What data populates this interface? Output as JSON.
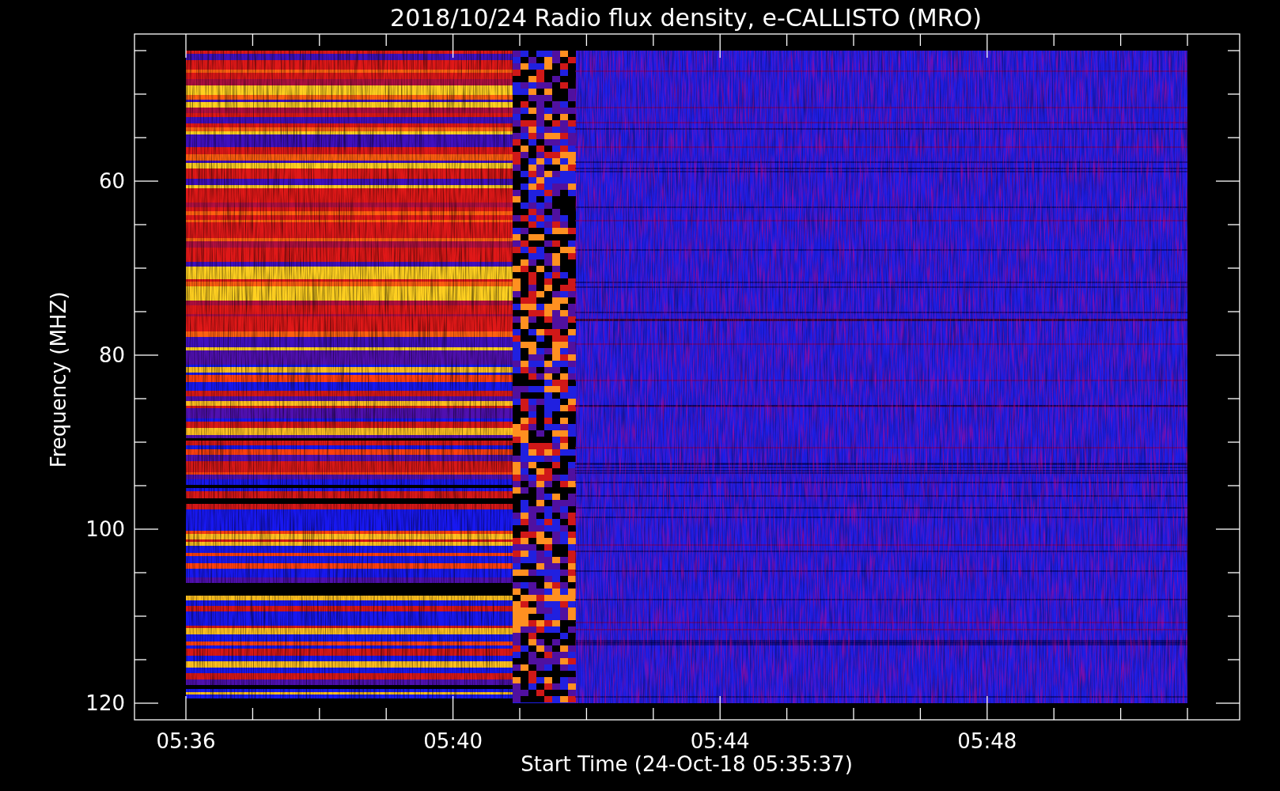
{
  "title": "2018/10/24  Radio flux density, e-CALLISTO (MRO)",
  "chart": {
    "xlabel": "Start Time (24-Oct-18 05:35:37)",
    "ylabel": "Frequency (MHZ)",
    "xticks": [
      "05:36",
      "05:40",
      "05:44",
      "05:48"
    ],
    "yticks": [
      "60",
      "80",
      "100",
      "120"
    ]
  }
}
